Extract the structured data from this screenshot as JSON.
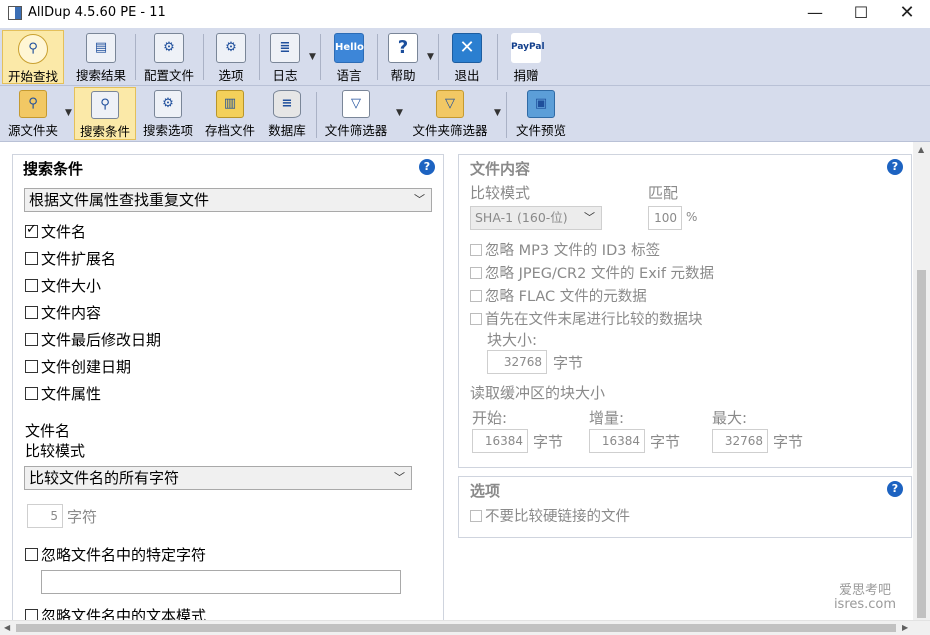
{
  "window": {
    "title": "AllDup 4.5.60 PE - 11",
    "minimize": "—",
    "maximize": "☐",
    "close": "✕"
  },
  "toolbar1": [
    {
      "label": "开始查找",
      "icon": "magnifier-icon"
    },
    {
      "label": "搜索结果",
      "icon": "results-icon"
    },
    {
      "label": "配置文件",
      "icon": "profile-icon"
    },
    {
      "label": "选项",
      "icon": "options-icon"
    },
    {
      "label": "日志",
      "icon": "log-icon"
    },
    {
      "label": "语言",
      "icon": "language-icon",
      "icon_text": "Hello"
    },
    {
      "label": "帮助",
      "icon": "help-icon",
      "icon_text": "?"
    },
    {
      "label": "退出",
      "icon": "exit-icon",
      "icon_text": "✕"
    },
    {
      "label": "捐赠",
      "icon": "paypal-icon",
      "icon_text": "PayPal"
    }
  ],
  "toolbar2": [
    {
      "label": "源文件夹",
      "icon": "folder-search-icon"
    },
    {
      "label": "搜索条件",
      "icon": "search-criteria-icon"
    },
    {
      "label": "搜索选项",
      "icon": "search-options-icon"
    },
    {
      "label": "存档文件",
      "icon": "archive-icon"
    },
    {
      "label": "数据库",
      "icon": "database-icon"
    },
    {
      "label": "文件筛选器",
      "icon": "file-filter-icon"
    },
    {
      "label": "文件夹筛选器",
      "icon": "folder-filter-icon"
    },
    {
      "label": "文件预览",
      "icon": "file-preview-icon"
    }
  ],
  "search_criteria": {
    "title": "搜索条件",
    "help": "?",
    "mode_select": "根据文件属性查找重复文件",
    "checks": [
      {
        "label": "文件名",
        "checked": true
      },
      {
        "label": "文件扩展名",
        "checked": false
      },
      {
        "label": "文件大小",
        "checked": false
      },
      {
        "label": "文件内容",
        "checked": false
      },
      {
        "label": "文件最后修改日期",
        "checked": false
      },
      {
        "label": "文件创建日期",
        "checked": false
      },
      {
        "label": "文件属性",
        "checked": false
      }
    ],
    "filename_label": "文件名",
    "compare_mode_label": "比较模式",
    "filename_mode_select": "比较文件名的所有字符",
    "char_count": "5",
    "char_unit": "字符",
    "ignore_chars_label": "忽略文件名中的特定字符",
    "ignore_chars_value": "",
    "ignore_pattern_label": "忽略文件名中的文本模式"
  },
  "file_content": {
    "title": "文件内容",
    "help": "?",
    "compare_mode_label": "比较模式",
    "match_label": "匹配",
    "hash_select": "SHA-1 (160-位)",
    "match_value": "100",
    "match_unit": "%",
    "checks": [
      "忽略 MP3 文件的 ID3 标签",
      "忽略 JPEG/CR2 文件的 Exif 元数据",
      "忽略 FLAC 文件的元数据",
      "首先在文件末尾进行比较的数据块"
    ],
    "block_size_label": "块大小:",
    "block_size_value": "32768",
    "byte_unit": "字节",
    "buffer_label": "读取缓冲区的块大小",
    "start_label": "开始:",
    "start_value": "16384",
    "increment_label": "增量:",
    "increment_value": "16384",
    "max_label": "最大:",
    "max_value": "32768"
  },
  "options": {
    "title": "选项",
    "help": "?",
    "hardlink_label": "不要比较硬链接的文件"
  },
  "watermark": {
    "line1": "爱思考吧",
    "line2": "isres.com"
  }
}
